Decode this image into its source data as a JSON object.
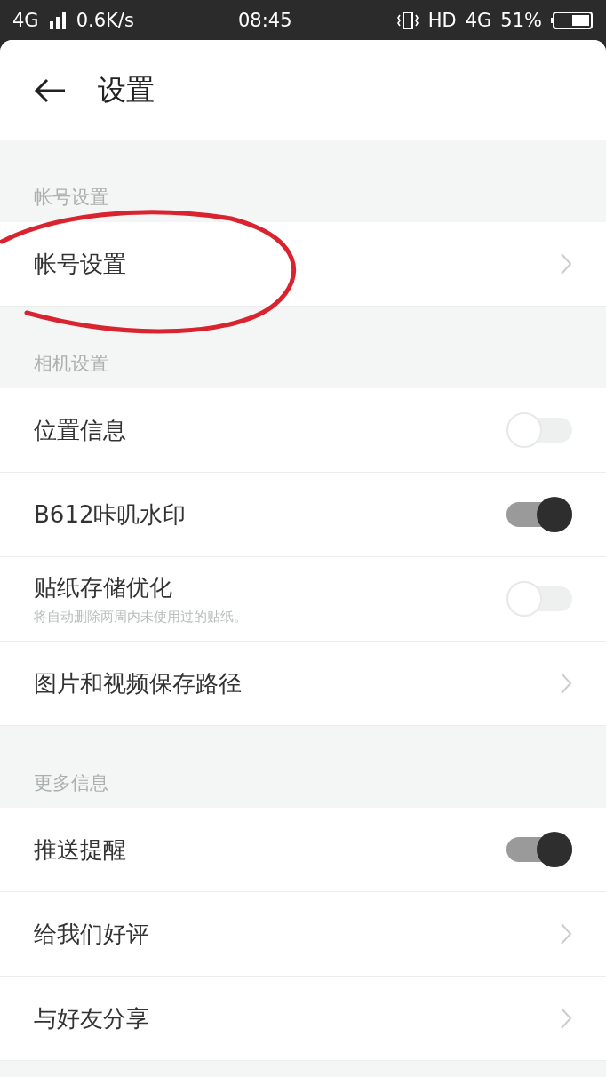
{
  "status_bar": {
    "network": "4G",
    "speed": "0.6K/s",
    "time": "08:45",
    "hd": "HD",
    "network_right": "4G",
    "battery": "51%"
  },
  "header": {
    "title": "设置"
  },
  "sections": [
    {
      "title": "帐号设置",
      "items": [
        {
          "kind": "link",
          "label": "帐号设置"
        }
      ]
    },
    {
      "title": "相机设置",
      "items": [
        {
          "kind": "toggle",
          "label": "位置信息",
          "on": false
        },
        {
          "kind": "toggle",
          "label": "B612咔叽水印",
          "on": true
        },
        {
          "kind": "toggle",
          "label": "贴纸存储优化",
          "description": "将自动删除两周内未使用过的贴纸。",
          "on": false
        },
        {
          "kind": "link",
          "label": "图片和视频保存路径"
        }
      ]
    },
    {
      "title": "更多信息",
      "items": [
        {
          "kind": "toggle",
          "label": "推送提醒",
          "on": true
        },
        {
          "kind": "link",
          "label": "给我们好评"
        },
        {
          "kind": "link",
          "label": "与好友分享"
        }
      ]
    }
  ]
}
